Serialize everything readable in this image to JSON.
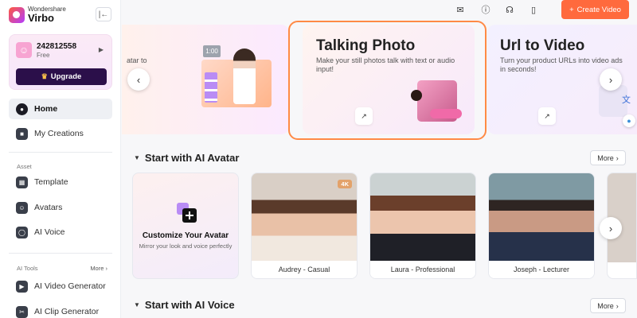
{
  "brand": {
    "sub": "Wondershare",
    "name": "Virbo"
  },
  "user": {
    "id": "242812558",
    "plan": "Free",
    "upgrade_label": "Upgrade"
  },
  "nav": {
    "home": "Home",
    "creations": "My Creations",
    "asset_label": "Asset",
    "template": "Template",
    "avatars": "Avatars",
    "voice": "AI Voice",
    "tools_label": "AI Tools",
    "tools_more": "More",
    "video_gen": "AI Video Generator",
    "clip_gen": "AI Clip Generator"
  },
  "topbar": {
    "create_label": "Create Video"
  },
  "banners": {
    "left_fragment": "atar to",
    "left_duration": "1:00",
    "mid_title": "Talking Photo",
    "mid_desc": "Make your still photos talk with text or audio input!",
    "right_title": "Url to Video",
    "right_desc": "Turn your product URLs into video ads in seconds!"
  },
  "sections": {
    "avatar_title": "Start with AI Avatar",
    "voice_title": "Start with AI Voice",
    "more_label": "More"
  },
  "customize": {
    "title": "Customize Your Avatar",
    "subtitle": "Mirror your look and voice perfectly"
  },
  "avatars": [
    {
      "name": "Audrey - Casual",
      "badge": "4K"
    },
    {
      "name": "Laura - Professional"
    },
    {
      "name": "Joseph - Lecturer"
    }
  ],
  "colors": {
    "accent": "#ff6a3d",
    "upgrade_bg": "#2b0f4a",
    "highlight": "#ff8a45"
  }
}
